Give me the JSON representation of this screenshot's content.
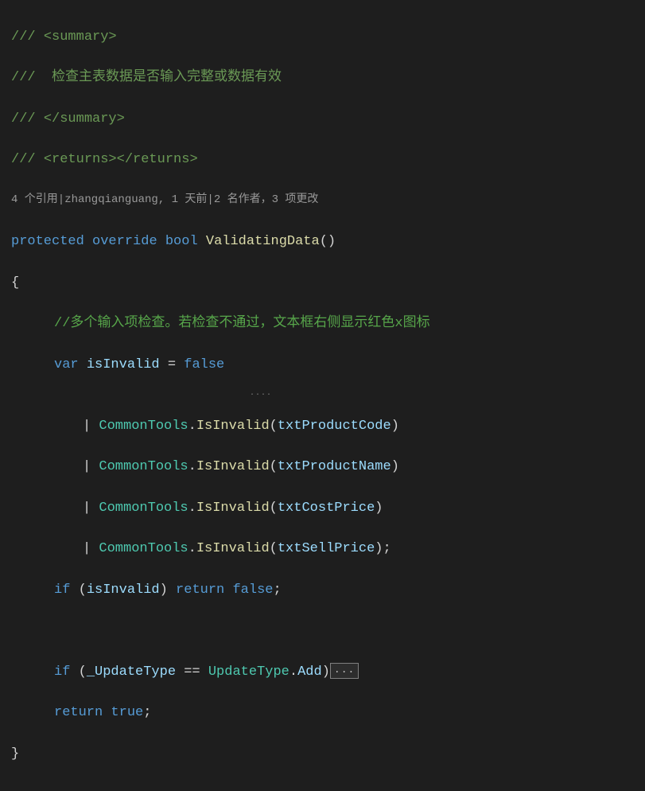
{
  "doc": {
    "s1": "/// ",
    "tag_summary_open": "<summary>",
    "s2": "///  ",
    "summary_text": "检查主表数据是否输入完整或数据有效",
    "s3": "/// ",
    "tag_summary_close": "</summary>",
    "s4": "/// ",
    "tag_returns": "<returns></returns>"
  },
  "codelens": {
    "text": "4 个引用|zhangqianguang, 1 天前|2 名作者，3 项更改"
  },
  "sig": {
    "kw_protected": "protected",
    "sp1": " ",
    "kw_override": "override",
    "sp2": " ",
    "type_bool": "bool",
    "sp3": " ",
    "method": "ValidatingData",
    "parens": "()"
  },
  "brace_open": "{",
  "comment_inner": "//多个输入项检查。若检查不通过，文本框右侧显示红色x图标",
  "decl": {
    "kw_var": "var",
    "sp1": " ",
    "id": "isInvalid",
    "sp2": " ",
    "eq": "=",
    "sp3": " ",
    "val": "false"
  },
  "dots_hint": "....",
  "call1": {
    "pipe": "| ",
    "cls": "CommonTools",
    "dot": ".",
    "m": "IsInvalid",
    "lp": "(",
    "arg": "txtProductCode",
    "rp": ")"
  },
  "call2": {
    "pipe": "| ",
    "cls": "CommonTools",
    "dot": ".",
    "m": "IsInvalid",
    "lp": "(",
    "arg": "txtProductName",
    "rp": ")"
  },
  "call3": {
    "pipe": "| ",
    "cls": "CommonTools",
    "dot": ".",
    "m": "IsInvalid",
    "lp": "(",
    "arg": "txtCostPrice",
    "rp": ")"
  },
  "call4": {
    "pipe": "| ",
    "cls": "CommonTools",
    "dot": ".",
    "m": "IsInvalid",
    "lp": "(",
    "arg": "txtSellPrice",
    "rp": ");",
    "semi": ""
  },
  "ifstmt": {
    "kw_if": "if",
    "sp1": " ",
    "lp": "(",
    "id": "isInvalid",
    "rp": ")",
    "sp2": " ",
    "kw_return": "return",
    "sp3": " ",
    "val": "false",
    "semi": ";"
  },
  "ifstmt2": {
    "kw_if": "if",
    "sp1": " ",
    "lp": "(",
    "id": "_UpdateType",
    "sp2": " ",
    "eq": "==",
    "sp3": " ",
    "cls": "UpdateType",
    "dot": ".",
    "mem": "Add",
    "rp": ")"
  },
  "collapse": "...",
  "ret": {
    "kw_return": "return",
    "sp1": " ",
    "val": "true",
    "semi": ";"
  },
  "brace_close": "}"
}
